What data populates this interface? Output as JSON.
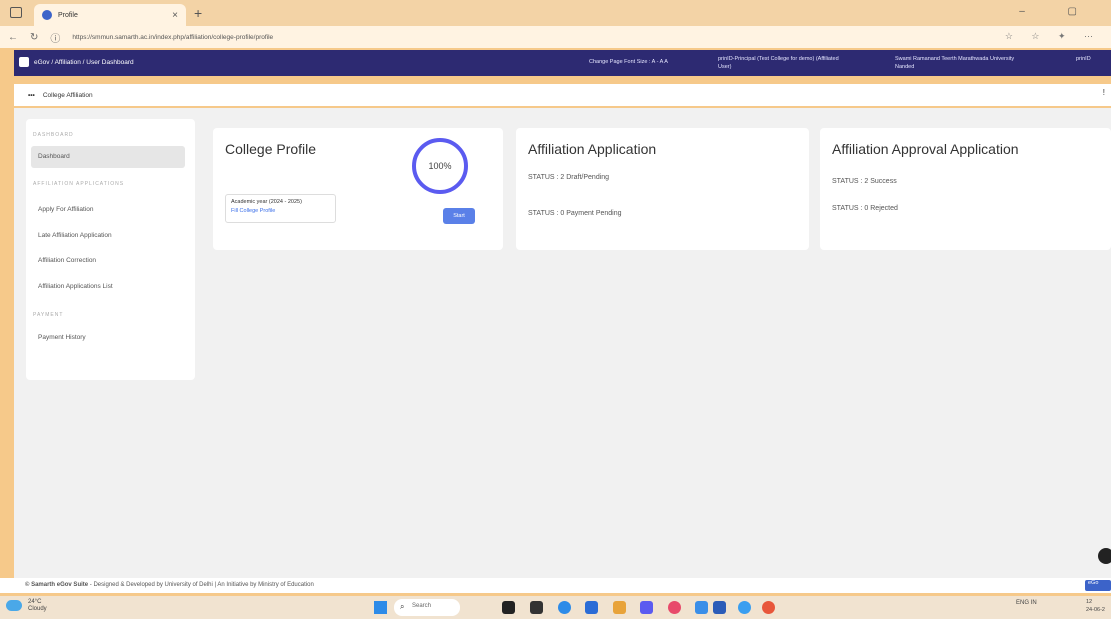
{
  "browser": {
    "tab_title": "Profile",
    "url": "https://smmun.samarth.ac.in/index.php/affiliation/college-profile/profile"
  },
  "header": {
    "app_name": "eGov",
    "breadcrumb": "eGov / Affiliation / User Dashboard",
    "font_size_label": "Change Page Font Size :  A -  A  A",
    "user_label_line1": "prinID-Principal (Test College for demo) (Affiliated",
    "user_label_line2": "User)",
    "university_line1": "Swami Ramanand Teerth Marathwada University",
    "university_line2": "Nanded",
    "user_short": "prinID"
  },
  "subheader": {
    "title": "College Affiliation"
  },
  "sidebar": {
    "section1": "DASHBOARD",
    "dashboard": "Dashboard",
    "section2": "AFFILIATION APPLICATIONS",
    "items": [
      "Apply For Affiliation",
      "Late Affiliation Application",
      "Affiliation Correction",
      "Affiliation Applications List"
    ],
    "section3": "PAYMENT",
    "payment_history": "Payment History"
  },
  "cards": {
    "profile": {
      "title": "College Profile",
      "percent": "100%",
      "academic_year": "Academic year (2024 - 2025)",
      "fill_link": "Fill College Profile",
      "start_label": "Start"
    },
    "affiliation": {
      "title": "Affiliation Application",
      "status1": "STATUS : 2 Draft/Pending",
      "status2": "STATUS : 0 Payment Pending"
    },
    "approval": {
      "title": "Affiliation Approval Application",
      "status1": "STATUS : 2 Success",
      "status2": "STATUS : 0 Rejected"
    }
  },
  "footer": {
    "brand": "© Samarth eGov Suite",
    "text": " - Designed & Developed by University of Delhi | An Initiative by Ministry of Education",
    "chip": "eGo"
  },
  "taskbar": {
    "temperature": "24°C",
    "weather": "Cloudy",
    "search": "Search",
    "lang": "ENG IN",
    "time": "12",
    "date": "24-06-2"
  }
}
